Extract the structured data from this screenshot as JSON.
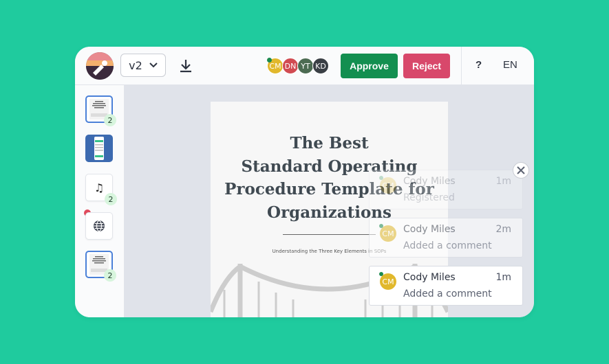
{
  "toolbar": {
    "version_label": "v2",
    "approve_label": "Approve",
    "reject_label": "Reject",
    "help_label": "?",
    "language_label": "EN"
  },
  "collaborators": [
    {
      "initials": "CM",
      "color": "#e1b82c",
      "online": true
    },
    {
      "initials": "DN",
      "color": "#d14b52",
      "online": false
    },
    {
      "initials": "YT",
      "color": "#4c6b52",
      "online": false
    },
    {
      "initials": "KD",
      "color": "#3a3f45",
      "online": false
    }
  ],
  "sidebar": {
    "items": [
      {
        "type": "document",
        "badge": "2"
      },
      {
        "type": "screenshot",
        "badge": ""
      },
      {
        "type": "music-icon",
        "badge": "2"
      },
      {
        "type": "globe-icon",
        "badge": ""
      },
      {
        "type": "document",
        "badge": "2"
      }
    ]
  },
  "document": {
    "title_lines": [
      "The Best",
      "Standard Operating",
      "Procedure Template for",
      "Organizations"
    ],
    "subtitle": "Understanding the Three Key Elements in SOPs"
  },
  "comments": [
    {
      "initials": "CM",
      "author": "Cody Miles",
      "time": "1m",
      "text": "Registered"
    },
    {
      "initials": "CM",
      "author": "Cody Miles",
      "time": "2m",
      "text": "Added a comment"
    },
    {
      "initials": "CM",
      "author": "Cody Miles",
      "time": "1m",
      "text": "Added a comment"
    }
  ],
  "colors": {
    "background": "#1fcb9e",
    "approve": "#138f50",
    "reject": "#d8486b",
    "selection": "#4a80d8"
  }
}
